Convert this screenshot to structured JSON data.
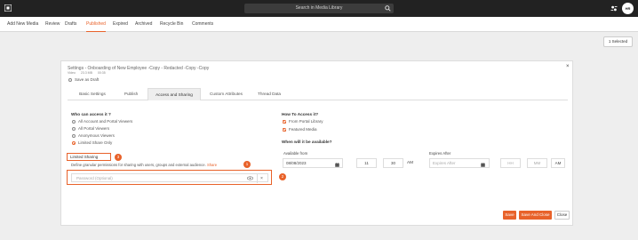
{
  "topbar": {
    "search_placeholder": "Search in Media Library",
    "avatar_initials": "HR"
  },
  "subnav": {
    "items": [
      "Add New Media",
      "Review",
      "Drafts",
      "Published",
      "Expired",
      "Archived",
      "Recycle Bin",
      "Comments"
    ],
    "active": "Published"
  },
  "selection": {
    "label": "1 Selected"
  },
  "modal": {
    "title": "Settings - Onboarding of New Employee -Copy - Redacted -Copy -Copy",
    "media_type": "Video",
    "size": "23.3 MB",
    "duration": "00:35",
    "save_as_draft": "Save as Draft",
    "close": "×",
    "tabs": [
      "Basic Settings",
      "Publish",
      "Access and Sharing",
      "Custom Attributes",
      "Thread Data"
    ],
    "active_tab": "Access and Sharing",
    "access": {
      "heading": "Who can access it ?",
      "options": [
        "All Account and Portal Viewers",
        "All Portal Viewers",
        "Anonymous Viewers",
        "Limited Share Only"
      ],
      "selected": "Limited Share Only",
      "limited_sharing_label": "Limited Sharing",
      "define_text": "Define granular permissions for sharing with users, groups and external audience.",
      "share_link": "Share",
      "password_placeholder": "Password (Optional)",
      "clear": "×",
      "badges": [
        "3",
        "1",
        "2"
      ]
    },
    "how": {
      "heading": "How To Access it?",
      "options": [
        "From Portal Library",
        "Featured Media"
      ],
      "checked": [
        true,
        true
      ]
    },
    "when": {
      "heading": "When will it be available?",
      "available_from_label": "Available from",
      "date": "08/08/2023",
      "hour": "11",
      "minute": "30",
      "ampm": "AM",
      "expires_after_label": "Expires After",
      "expires_placeholder": "Expires After",
      "hh_placeholder": "HH",
      "mm_placeholder": "MM",
      "expires_ampm": "AM"
    },
    "footer": {
      "save": "Save",
      "save_and_close": "Save And Close",
      "close": "Close"
    }
  },
  "colors": {
    "accent": "#e8622a",
    "topbar": "#222222"
  },
  "icons": [
    "logo-icon",
    "search-icon",
    "settings-icon",
    "calendar-icon",
    "eye-icon",
    "close-icon"
  ]
}
